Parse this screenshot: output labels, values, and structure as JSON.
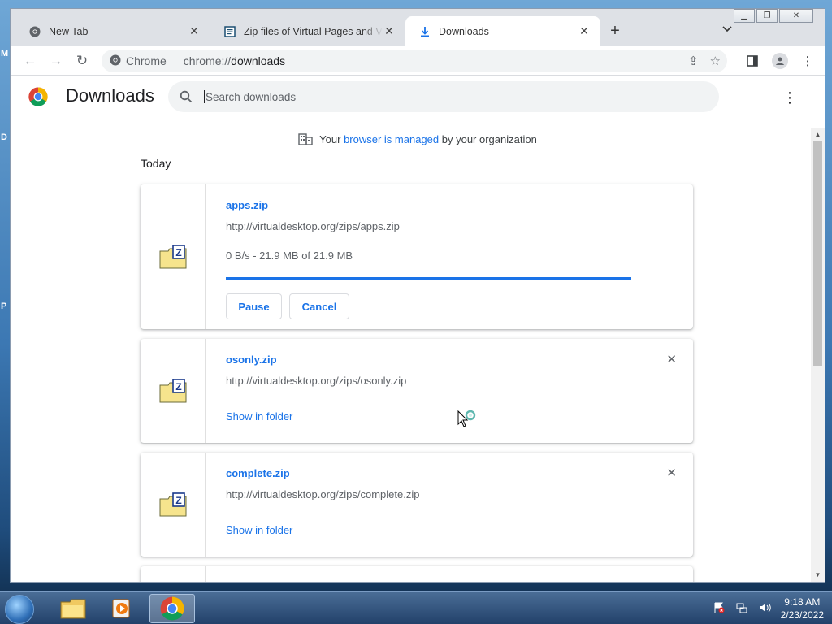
{
  "browser": {
    "tabs": [
      {
        "label": "New Tab",
        "icon": "chrome-icon",
        "active": false
      },
      {
        "label": "Zip files of Virtual Pages and Virtual",
        "icon": "document-icon",
        "active": false
      },
      {
        "label": "Downloads",
        "icon": "download-icon",
        "active": true
      }
    ],
    "omnibox": {
      "site_label": "Chrome",
      "url_prefix": "chrome://",
      "url_host": "downloads"
    }
  },
  "downloads_page": {
    "title": "Downloads",
    "search_placeholder": "Search downloads",
    "managed_notice": {
      "before": "Your",
      "link": "browser is managed",
      "after": "by your organization"
    },
    "section_label": "Today",
    "items": [
      {
        "file_name": "apps.zip",
        "url": "http://virtualdesktop.org/zips/apps.zip",
        "status": "0 B/s - 21.9 MB of 21.9 MB",
        "progress": 1.0,
        "pause_label": "Pause",
        "cancel_label": "Cancel"
      },
      {
        "file_name": "osonly.zip",
        "url": "http://virtualdesktop.org/zips/osonly.zip",
        "show_in_folder_label": "Show in folder"
      },
      {
        "file_name": "complete.zip",
        "url": "http://virtualdesktop.org/zips/complete.zip",
        "show_in_folder_label": "Show in folder"
      }
    ]
  },
  "taskbar": {
    "apps": [
      "file-explorer-icon",
      "media-player-icon",
      "chrome-icon"
    ],
    "clock_time": "9:18 AM",
    "clock_date": "2/23/2022"
  },
  "desktop_letters": [
    "M",
    "D",
    "P"
  ],
  "colors": {
    "accent": "#1a73e8",
    "tab_strip": "#dee1e6",
    "search_bg": "#f1f3f4"
  }
}
